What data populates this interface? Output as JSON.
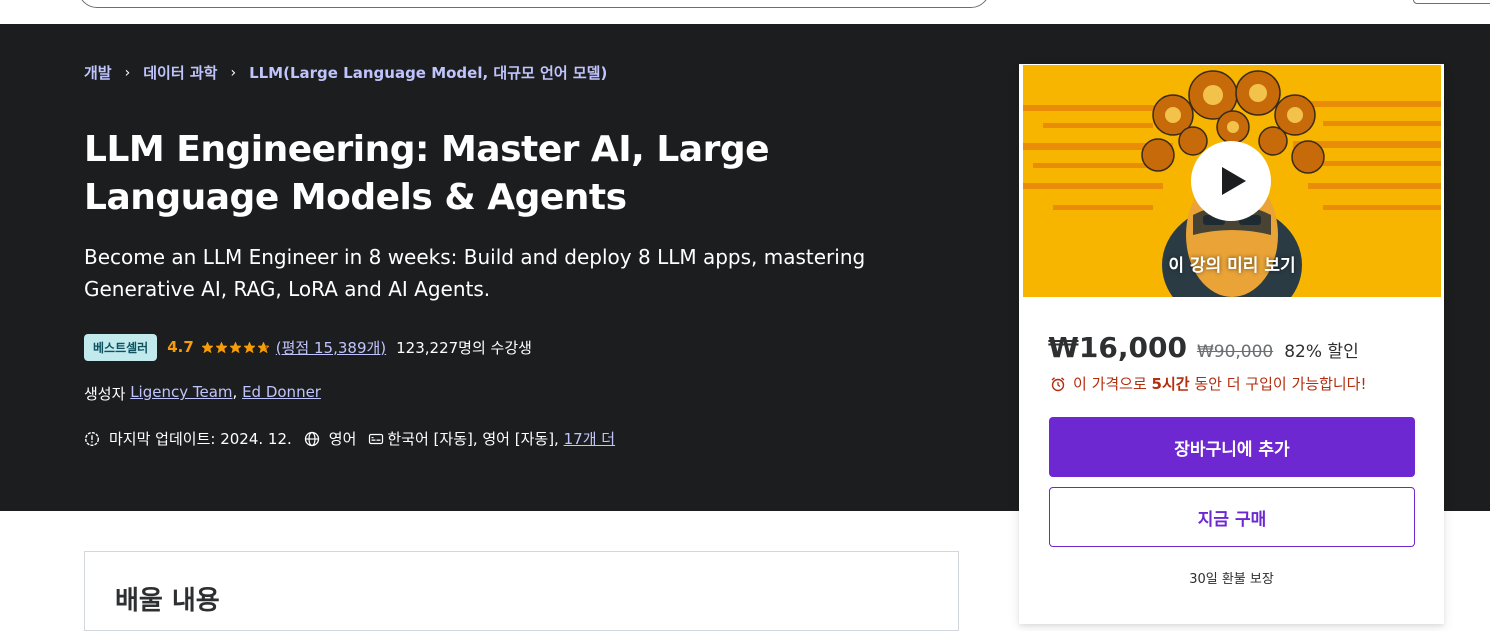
{
  "breadcrumb": {
    "items": [
      "개발",
      "데이터 과학",
      "LLM(Large Language Model, 대규모 언어 모델)"
    ],
    "separator": "›"
  },
  "course": {
    "title": "LLM Engineering: Master AI, Large Language Models & Agents",
    "subtitle": "Become an LLM Engineer in 8 weeks: Build and deploy 8 LLM apps, mastering Generative AI, RAG, LoRA and AI Agents.",
    "badge": "베스트셀러",
    "rating": "4.7",
    "rating_fraction": 0.94,
    "rating_count": "(평점 15,389개)",
    "students": "123,227명의 수강생",
    "creator_label": "생성자",
    "creators": [
      "Ligency Team",
      "Ed Donner"
    ],
    "creator_sep": ", ",
    "last_updated": "마지막 업데이트: 2024. 12.",
    "language": "영어",
    "captions": "한국어 [자동], 영어 [자동],",
    "captions_more": "17개 더"
  },
  "learn": {
    "title": "배울 내용"
  },
  "sidebar": {
    "preview_label": "이 강의 미리 보기",
    "price": "₩16,000",
    "original_price": "₩90,000",
    "discount": "82% 할인",
    "timer_pre": "이 가격으로 ",
    "timer_time": "5시간",
    "timer_post": " 동안 더 구입이 가능합니다!",
    "add_to_cart": "장바구니에 추가",
    "buy_now": "지금 구매",
    "guarantee": "30일 환불 보장"
  },
  "colors": {
    "hero_bg": "#1c1d1f",
    "accent_purple": "#6d28d2",
    "link_lavender": "#c0c4fc",
    "rating_orange": "#f69c08",
    "badge_bg": "#c2e9eb",
    "alert_red": "#b32d0f",
    "preview_yellow": "#f7b500"
  },
  "icons": {
    "breadcrumb_separator": "chevron-right-icon",
    "update": "alert-badge-icon",
    "language": "globe-icon",
    "captions": "closed-caption-icon",
    "timer": "alarm-clock-icon",
    "play": "play-icon"
  }
}
